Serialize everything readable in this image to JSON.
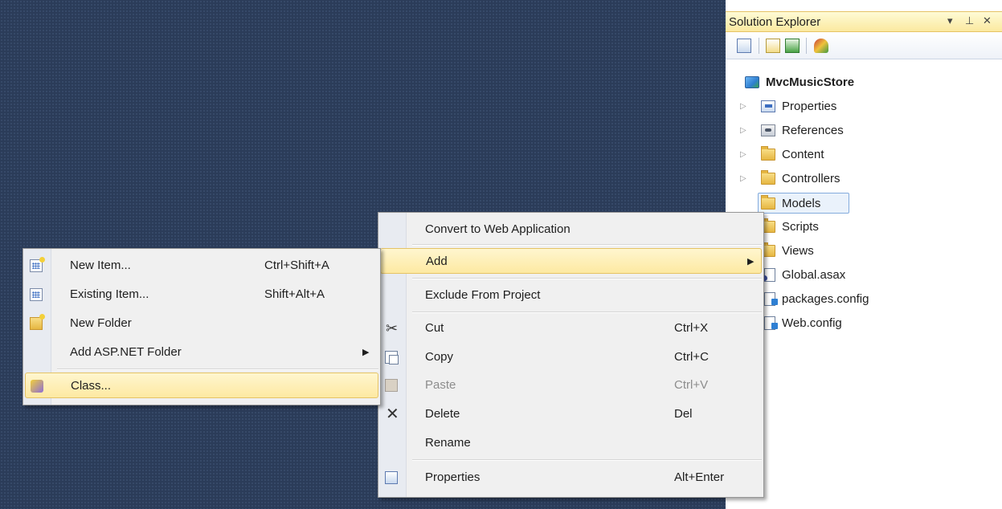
{
  "solution_explorer": {
    "title": "Solution Explorer",
    "controls": {
      "dropdown": "▾",
      "pin": "⊥",
      "close": "✕"
    },
    "project": "MvcMusicStore",
    "items": [
      {
        "label": "Properties",
        "icon": "properties-icon",
        "expandable": true
      },
      {
        "label": "References",
        "icon": "references-icon",
        "expandable": true
      },
      {
        "label": "Content",
        "icon": "folder-icon",
        "expandable": true
      },
      {
        "label": "Controllers",
        "icon": "folder-icon",
        "expandable": true
      },
      {
        "label": "Models",
        "icon": "folder-icon",
        "expandable": false,
        "selected": true
      },
      {
        "label": "Scripts",
        "icon": "folder-icon",
        "expandable": false
      },
      {
        "label": "Views",
        "icon": "folder-icon",
        "expandable": false
      },
      {
        "label": "Global.asax",
        "icon": "global-asax-icon",
        "expandable": false
      },
      {
        "label": "packages.config",
        "icon": "config-file-icon",
        "expandable": false
      },
      {
        "label": "Web.config",
        "icon": "config-file-icon",
        "expandable": false
      }
    ]
  },
  "context_menu": {
    "items": [
      {
        "label": "Convert to Web Application",
        "shortcut": ""
      },
      {
        "label": "Add",
        "shortcut": "",
        "submenu": true,
        "highlighted": true
      },
      {
        "label": "Exclude From Project",
        "shortcut": ""
      },
      {
        "label": "Cut",
        "shortcut": "Ctrl+X",
        "icon": "scissors-icon"
      },
      {
        "label": "Copy",
        "shortcut": "Ctrl+C",
        "icon": "copy-icon"
      },
      {
        "label": "Paste",
        "shortcut": "Ctrl+V",
        "icon": "paste-icon",
        "disabled": true
      },
      {
        "label": "Delete",
        "shortcut": "Del",
        "icon": "delete-icon"
      },
      {
        "label": "Rename",
        "shortcut": ""
      },
      {
        "label": "Properties",
        "shortcut": "Alt+Enter",
        "icon": "properties-icon"
      }
    ]
  },
  "add_submenu": {
    "items": [
      {
        "label": "New Item...",
        "shortcut": "Ctrl+Shift+A",
        "icon": "new-item-icon"
      },
      {
        "label": "Existing Item...",
        "shortcut": "Shift+Alt+A",
        "icon": "existing-item-icon"
      },
      {
        "label": "New Folder",
        "shortcut": "",
        "icon": "new-folder-icon"
      },
      {
        "label": "Add ASP.NET Folder",
        "shortcut": "",
        "submenu": true
      },
      {
        "label": "Class...",
        "shortcut": "",
        "icon": "class-icon",
        "highlighted": true
      }
    ]
  },
  "colors": {
    "workspace_background": "#2b3c59",
    "highlight_fill": "#fde9a2",
    "highlight_border": "#e5c365",
    "menu_background": "#f0f0f0"
  }
}
